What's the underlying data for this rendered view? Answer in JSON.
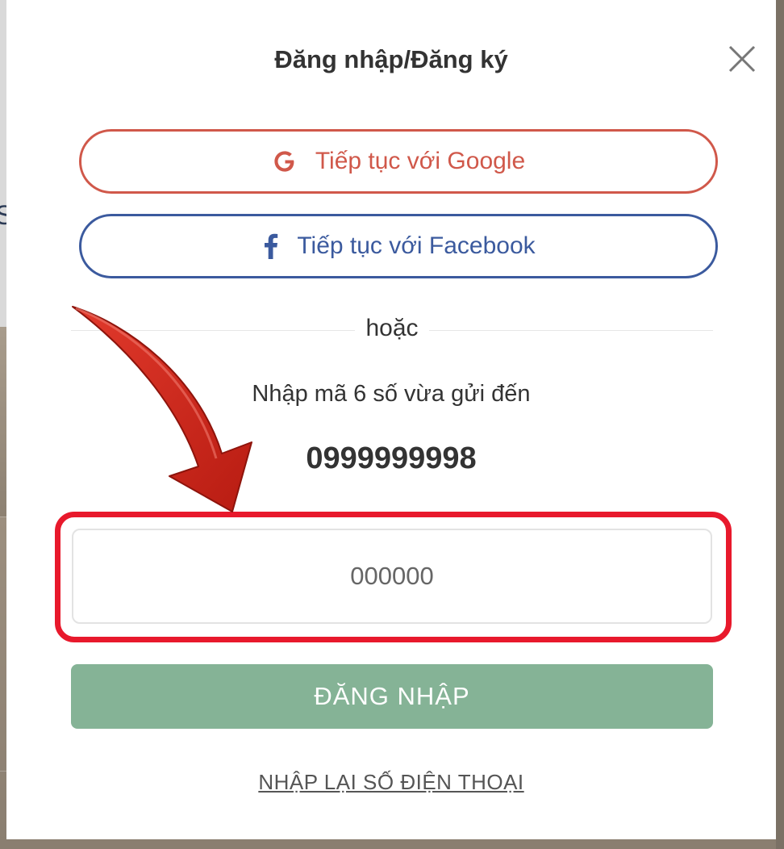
{
  "modal": {
    "title": "Đăng nhập/Đăng ký"
  },
  "social": {
    "google_label": "Tiếp tục với Google",
    "facebook_label": "Tiếp tục với Facebook"
  },
  "divider": {
    "text": "hoặc"
  },
  "otp": {
    "instruction": "Nhập mã 6 số vừa gửi đến",
    "phone_number": "0999999998",
    "placeholder": "000000",
    "value": ""
  },
  "actions": {
    "login_label": "ĐĂNG NHẬP",
    "reenter_phone_label": "NHẬP LẠI SỐ ĐIỆN THOẠI"
  },
  "background": {
    "partial_letter": "S"
  },
  "icons": {
    "google": "google-icon",
    "facebook": "facebook-icon",
    "close": "close-icon",
    "annotation_arrow": "arrow-annotation-icon"
  },
  "colors": {
    "google": "#d0584a",
    "facebook": "#3b5a9e",
    "login_button": "#85b396",
    "highlight": "#e8192c",
    "arrow": "#cc2418",
    "text": "#333333"
  }
}
